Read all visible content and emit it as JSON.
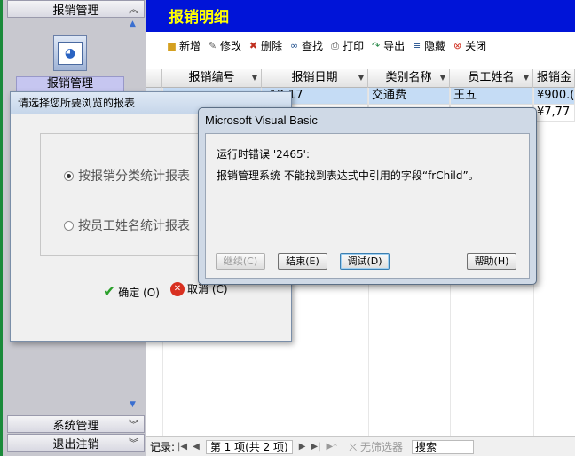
{
  "nav": {
    "top_section": "报销管理",
    "item_label": "报销管理",
    "section2": "系统管理",
    "section3": "退出注销",
    "chevron": "»",
    "tri": "▲",
    "tri_down": "▼"
  },
  "main": {
    "title": "报销明细",
    "toolbar": [
      "新增",
      "修改",
      "删除",
      "查找",
      "打印",
      "导出",
      "隐藏",
      "关闭"
    ]
  },
  "grid": {
    "columns": [
      "报销编号",
      "报销日期",
      "类别名称",
      "员工姓名",
      "报销金"
    ],
    "rows": [
      [
        "",
        "-12-17",
        "交通费",
        "王五",
        "¥900.("
      ],
      [
        "",
        "",
        "",
        "",
        "¥7,77"
      ]
    ]
  },
  "status": {
    "label": "记录:",
    "page": "第 1 项(共 2 项)",
    "filter": "无筛选器",
    "search": "搜索"
  },
  "report_dialog": {
    "title": "请选择您所要浏览的报表",
    "option1": "按报销分类统计报表",
    "option2": "按员工姓名统计报表",
    "ok": "确定 (O)",
    "cancel": "取消 (C)"
  },
  "vb_dialog": {
    "title": "Microsoft Visual Basic",
    "line1": "运行时错误 '2465':",
    "line2": "报销管理系统 不能找到表达式中引用的字段“frChild”。",
    "btn_continue": "继续(C)",
    "btn_end": "结束(E)",
    "btn_debug": "调试(D)",
    "btn_help": "帮助(H)"
  },
  "colors": {
    "header_bg": "#0014d8",
    "title_fg": "#ffff00",
    "nav_bg": "#c8c8cf",
    "selection": "#c5dcf5"
  }
}
